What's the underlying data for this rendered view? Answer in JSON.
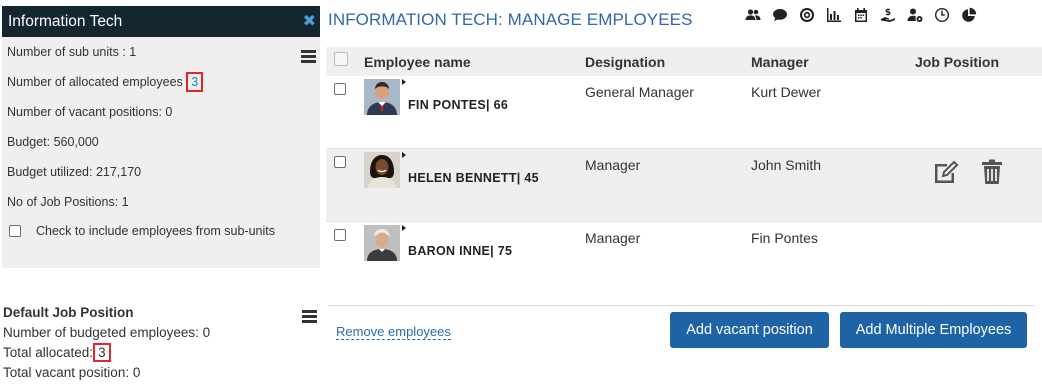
{
  "unit": {
    "title": "Information Tech",
    "close_icon": "close-icon",
    "stats": {
      "sub_units": "Number of sub units : 1",
      "allocated_label": "Number of allocated employees",
      "allocated_value": "3",
      "vacant": "Number of vacant positions: 0",
      "budget": "Budget: 560,000",
      "budget_utilized": "Budget utilized: 217,170",
      "job_positions": "No of Job Positions: 1"
    },
    "include_subunits_label": "Check to include employees from sub-units",
    "include_subunits_checked": false
  },
  "default_job_position": {
    "title": "Default Job Position",
    "budgeted": "Number of budgeted employees: 0",
    "total_allocated_label": "Total allocated:",
    "total_allocated_value": "3",
    "total_vacant": "Total vacant position: 0"
  },
  "page": {
    "title": "INFORMATION TECH: MANAGE EMPLOYEES"
  },
  "toolbar": [
    "users-icon",
    "chat-icon",
    "target-icon",
    "bar-chart-icon",
    "calendar-icon",
    "salary-icon",
    "user-settings-icon",
    "clock-icon",
    "pie-chart-icon"
  ],
  "table": {
    "headers": {
      "name": "Employee name",
      "designation": "Designation",
      "manager": "Manager",
      "job_position": "Job Position"
    },
    "rows": [
      {
        "name": "FIN PONTES| 66",
        "designation": "General Manager",
        "manager": "Kurt Dewer"
      },
      {
        "name": "HELEN BENNETT| 45",
        "designation": "Manager",
        "manager": "John Smith"
      },
      {
        "name": "BARON INNE| 75",
        "designation": "Manager",
        "manager": "Fin Pontes"
      }
    ]
  },
  "footer": {
    "remove_link": "Remove employees",
    "add_vacant": "Add vacant position",
    "add_multiple": "Add Multiple Employees"
  },
  "colors": {
    "header_bg": "#14262f",
    "accent": "#1e63a5",
    "title": "#2e6aa8",
    "highlight_box": "#e02828"
  }
}
